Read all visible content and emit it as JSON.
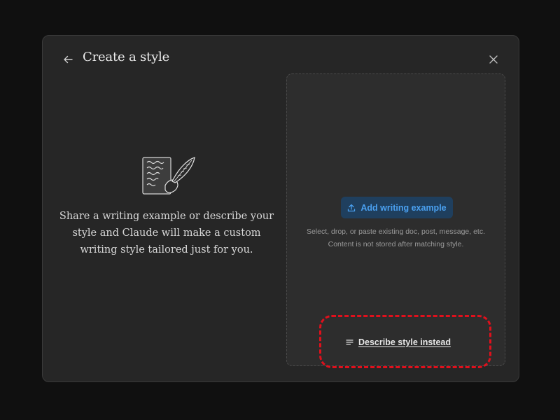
{
  "dialog": {
    "title": "Create a style"
  },
  "intro": {
    "line1": "Share a writing example or describe your",
    "line2": "style and Claude will make a custom",
    "line3": "writing style tailored just for you."
  },
  "upload": {
    "add_button_label": "Add writing example",
    "hint_line1": "Select, drop, or paste existing doc, post, message, etc.",
    "hint_line2": "Content is not stored after matching style."
  },
  "describe": {
    "label": "Describe style instead"
  },
  "icons": {
    "back": "arrow-left-icon",
    "close": "close-icon",
    "upload": "upload-icon",
    "describe": "text-lines-icon",
    "illustration": "quill-and-page-illustration"
  },
  "colors": {
    "background": "#101010",
    "modal": "#262626",
    "drop_zone": "#2d2d2d",
    "accent": "#4aa0f0",
    "accent_bg": "#1f3f5e",
    "highlight": "#e0101c"
  }
}
